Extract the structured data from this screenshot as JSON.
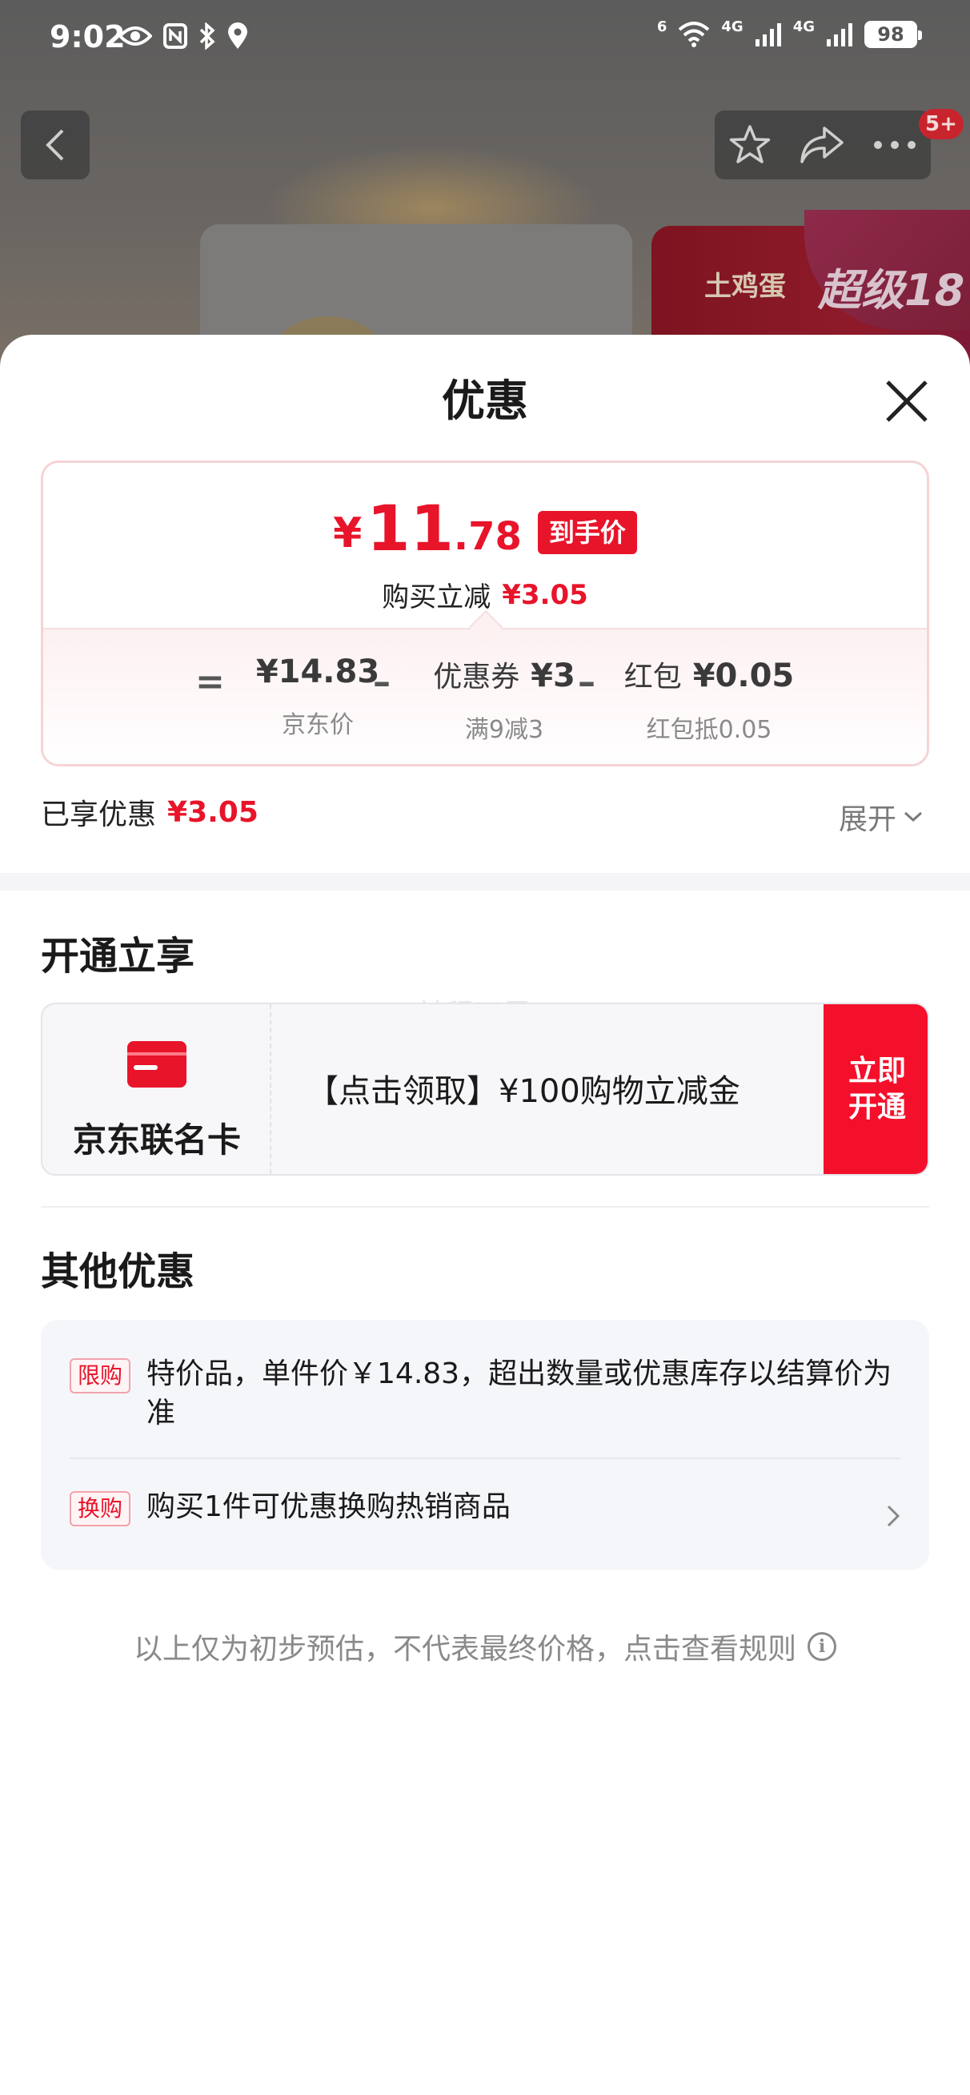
{
  "status_bar": {
    "time": "9:02",
    "battery": "98",
    "net_1": "4G",
    "net_2": "4G",
    "wifi_label": "6"
  },
  "top_nav": {
    "badge": "5+"
  },
  "background": {
    "banner_text": "土鸡蛋",
    "badge_text": "超级18"
  },
  "sheet": {
    "title": "优惠",
    "price_card": {
      "yen": "¥",
      "price_int": "11",
      "price_dec": ".78",
      "price_tag": "到手价",
      "save_label": "购买立减",
      "save_amount": "¥3.05",
      "breakdown": {
        "eq": "=",
        "minus": "–",
        "jd_price": "¥14.83",
        "jd_price_label": "京东价",
        "coupon_prefix": "优惠券",
        "coupon_value": "¥3",
        "coupon_label": "满9减3",
        "redpack_prefix": "红包",
        "redpack_value": "¥0.05",
        "redpack_label": "红包抵0.05"
      }
    },
    "enjoyed_label": "已享优惠",
    "enjoyed_amount": "¥3.05",
    "expand_label": "展开",
    "open_section_title": "开通立享",
    "watermark": "前程万里",
    "member_card": {
      "name": "京东联名卡",
      "offer": "【点击领取】¥100购物立减金",
      "cta": "立即\n开通"
    },
    "other_section_title": "其他优惠",
    "other_offers": [
      {
        "tag": "限购",
        "text": "特价品，单件价￥14.83，超出数量或优惠库存以结算价为准"
      },
      {
        "tag": "换购",
        "text": "购买1件可优惠换购热销商品"
      }
    ],
    "footnote": "以上仅为初步预估，不代表最终价格，点击查看规则",
    "info_icon_glyph": "i"
  },
  "colors": {
    "accent_red": "#e8142a",
    "cta_red": "#f4102b"
  }
}
